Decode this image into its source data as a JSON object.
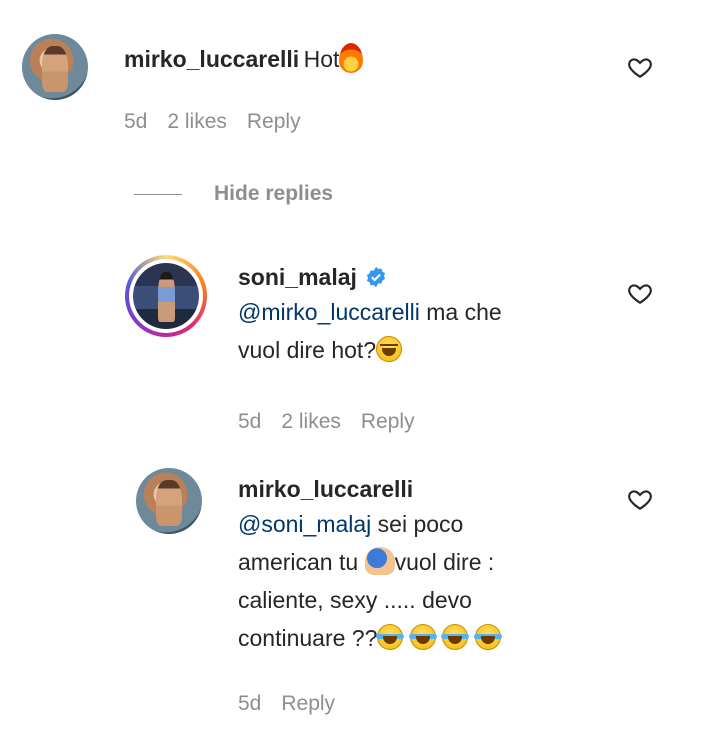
{
  "comments": [
    {
      "username": "mirko_luccarelli",
      "text": "Hot",
      "emoji": "fire",
      "age": "5d",
      "likes": "2 likes",
      "reply": "Reply"
    },
    {
      "username": "soni_malaj",
      "verified": true,
      "mention": "@mirko_luccarelli",
      "text_line1": " ma che",
      "text_line2": "vuol dire hot?",
      "emoji": "grinning-squinting",
      "age": "5d",
      "likes": "2 likes",
      "reply": "Reply"
    },
    {
      "username": "mirko_luccarelli",
      "mention": "@soni_malaj",
      "text_line1": " sei poco",
      "text_line2_a": "american tu ",
      "text_line2_b": "vuol dire :",
      "text_line3": "caliente, sexy ..... devo",
      "text_line4": "continuare ??",
      "emojis": [
        "facepalm",
        "joy",
        "joy",
        "joy",
        "joy"
      ],
      "age": "5d",
      "reply": "Reply"
    }
  ],
  "thread": {
    "hide_replies": "Hide replies"
  },
  "colors": {
    "text": "#262626",
    "muted": "#8e8e8e",
    "mention": "#00376b",
    "verified": "#3897f0"
  }
}
